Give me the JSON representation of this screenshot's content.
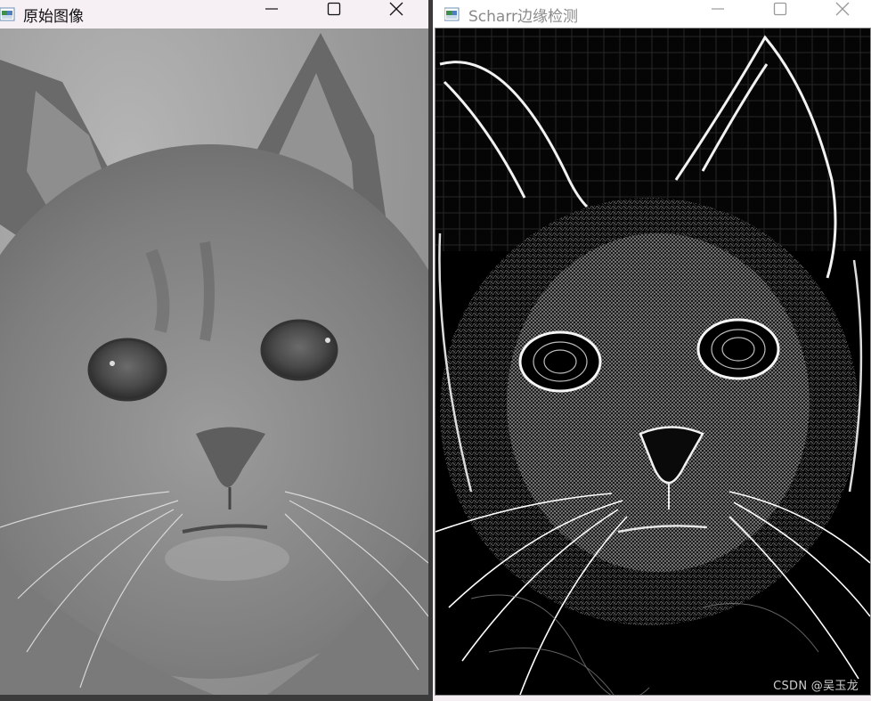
{
  "left_window": {
    "title": "原始图像",
    "icon": "opencv-window-icon",
    "controls": {
      "minimize": "minimize-icon",
      "maximize": "maximize-icon",
      "close": "close-icon"
    }
  },
  "right_window": {
    "title": "Scharr边缘检测",
    "icon": "opencv-window-icon",
    "controls": {
      "minimize": "minimize-icon",
      "maximize": "maximize-icon",
      "close": "close-icon"
    },
    "watermark": "CSDN @吴玉龙"
  },
  "colors": {
    "left_titlebar": "#f6eff3",
    "right_titlebar": "#ffffff",
    "edge_background": "#000000"
  }
}
